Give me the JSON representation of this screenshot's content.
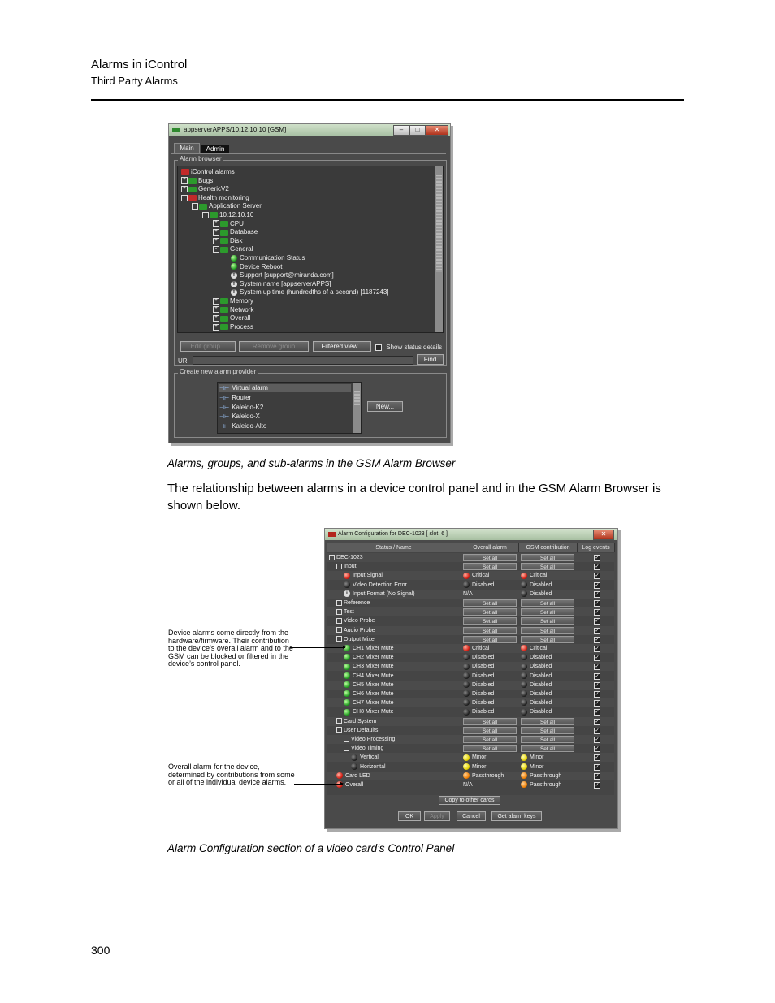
{
  "header": {
    "title": "Alarms in iControl",
    "subtitle": "Third Party Alarms"
  },
  "page_number": "300",
  "caption1": "Alarms, groups, and sub-alarms in the GSM Alarm Browser",
  "body_text": "The relationship between alarms in a device control panel and in the GSM Alarm Browser is shown below.",
  "caption2": "Alarm Configuration section of a video card’s Control Panel",
  "window1": {
    "title": "appserverAPPS/10.12.10.10 [GSM]",
    "tabs": [
      "Main",
      "Admin"
    ],
    "alarm_browser_label": "Alarm browser",
    "tree": [
      {
        "label": "iControl alarms",
        "icon": "folder-red",
        "depth": 0,
        "toggle": ""
      },
      {
        "label": "Bugs",
        "icon": "folder-green",
        "depth": 0,
        "toggle": "+"
      },
      {
        "label": "GenericV2",
        "icon": "folder-green",
        "depth": 0,
        "toggle": "+"
      },
      {
        "label": "Health monitoring",
        "icon": "folder-red",
        "depth": 0,
        "toggle": "-"
      },
      {
        "label": "Application Server",
        "icon": "folder-green",
        "depth": 1,
        "toggle": "-"
      },
      {
        "label": "10.12.10.10",
        "icon": "folder-green",
        "depth": 2,
        "toggle": "-"
      },
      {
        "label": "CPU",
        "icon": "folder-green",
        "depth": 3,
        "toggle": "+"
      },
      {
        "label": "Database",
        "icon": "folder-green",
        "depth": 3,
        "toggle": "+"
      },
      {
        "label": "Disk",
        "icon": "folder-green",
        "depth": 3,
        "toggle": "+"
      },
      {
        "label": "General",
        "icon": "folder-green",
        "depth": 3,
        "toggle": "-"
      },
      {
        "label": "Communication Status",
        "icon": "led-green",
        "depth": 4,
        "toggle": ""
      },
      {
        "label": "Device Reboot",
        "icon": "led-green",
        "depth": 4,
        "toggle": ""
      },
      {
        "label": "Support [support@miranda.com]",
        "icon": "led-t",
        "depth": 4,
        "toggle": ""
      },
      {
        "label": "System name [appserverAPPS]",
        "icon": "led-t",
        "depth": 4,
        "toggle": ""
      },
      {
        "label": "System up time (hundredths of a second) [1187243]",
        "icon": "led-t",
        "depth": 4,
        "toggle": ""
      },
      {
        "label": "Memory",
        "icon": "folder-green",
        "depth": 3,
        "toggle": "+"
      },
      {
        "label": "Network",
        "icon": "folder-green",
        "depth": 3,
        "toggle": "+"
      },
      {
        "label": "Overall",
        "icon": "folder-green",
        "depth": 3,
        "toggle": "+"
      },
      {
        "label": "Process",
        "icon": "folder-green",
        "depth": 3,
        "toggle": "+"
      }
    ],
    "buttons": {
      "edit_label": "Edit group...",
      "remove_label": "Remove group",
      "filtered_label": "Filtered view...",
      "find_label": "Find",
      "new_label": "New..."
    },
    "show_status_label": "Show status details",
    "uri_label": "URI",
    "create_provider_label": "Create new alarm provider",
    "providers": [
      "Virtual alarm",
      "Router",
      "Kaleido-K2",
      "Kaleido-X",
      "Kaleido-Alto"
    ]
  },
  "window2": {
    "title": "Alarm Configuration for DEC-1023 [ slot: 6 ]",
    "headers": [
      "Status / Name",
      "Overall alarm",
      "GSM contribution",
      "Log events"
    ],
    "set_all_label": "Set all",
    "rows": [
      {
        "name": "DEC-1023",
        "indent": 0,
        "icon": "tsq",
        "overall": "set",
        "gsm": "set"
      },
      {
        "name": "Input",
        "indent": 1,
        "icon": "tsq",
        "overall": "set",
        "gsm": "set"
      },
      {
        "name": "Input Signal",
        "indent": 2,
        "icon": "led-red",
        "overall": "Critical",
        "overall_led": "led-red",
        "gsm": "Critical",
        "gsm_led": "led-red"
      },
      {
        "name": "Video Detection Error",
        "indent": 2,
        "icon": "led-dark",
        "overall": "Disabled",
        "overall_led": "led-dark",
        "gsm": "Disabled",
        "gsm_led": "led-dark"
      },
      {
        "name": "Input Format (No Signal)",
        "indent": 2,
        "icon": "led-info",
        "overall": "N/A",
        "overall_led": "",
        "gsm": "Disabled",
        "gsm_led": "led-dark"
      },
      {
        "name": "Reference",
        "indent": 1,
        "icon": "tsq",
        "overall": "set",
        "gsm": "set"
      },
      {
        "name": "Test",
        "indent": 1,
        "icon": "tsq",
        "overall": "set",
        "gsm": "set"
      },
      {
        "name": "Video Probe",
        "indent": 1,
        "icon": "tsq",
        "overall": "set",
        "gsm": "set"
      },
      {
        "name": "Audio Probe",
        "indent": 1,
        "icon": "tsq",
        "overall": "set",
        "gsm": "set"
      },
      {
        "name": "Output Mixer",
        "indent": 1,
        "icon": "tsq",
        "overall": "set",
        "gsm": "set"
      },
      {
        "name": "CH1 Mixer Mute",
        "indent": 2,
        "icon": "led-green",
        "overall": "Critical",
        "overall_led": "led-red",
        "gsm": "Critical",
        "gsm_led": "led-red"
      },
      {
        "name": "CH2 Mixer Mute",
        "indent": 2,
        "icon": "led-green",
        "overall": "Disabled",
        "overall_led": "led-dark",
        "gsm": "Disabled",
        "gsm_led": "led-dark"
      },
      {
        "name": "CH3 Mixer Mute",
        "indent": 2,
        "icon": "led-green",
        "overall": "Disabled",
        "overall_led": "led-dark",
        "gsm": "Disabled",
        "gsm_led": "led-dark"
      },
      {
        "name": "CH4 Mixer Mute",
        "indent": 2,
        "icon": "led-green",
        "overall": "Disabled",
        "overall_led": "led-dark",
        "gsm": "Disabled",
        "gsm_led": "led-dark"
      },
      {
        "name": "CH5 Mixer Mute",
        "indent": 2,
        "icon": "led-green",
        "overall": "Disabled",
        "overall_led": "led-dark",
        "gsm": "Disabled",
        "gsm_led": "led-dark"
      },
      {
        "name": "CH6 Mixer Mute",
        "indent": 2,
        "icon": "led-green",
        "overall": "Disabled",
        "overall_led": "led-dark",
        "gsm": "Disabled",
        "gsm_led": "led-dark"
      },
      {
        "name": "CH7 Mixer Mute",
        "indent": 2,
        "icon": "led-green",
        "overall": "Disabled",
        "overall_led": "led-dark",
        "gsm": "Disabled",
        "gsm_led": "led-dark"
      },
      {
        "name": "CH8 Mixer Mute",
        "indent": 2,
        "icon": "led-green",
        "overall": "Disabled",
        "overall_led": "led-dark",
        "gsm": "Disabled",
        "gsm_led": "led-dark"
      },
      {
        "name": "Card System",
        "indent": 1,
        "icon": "tsq",
        "overall": "set",
        "gsm": "set"
      },
      {
        "name": "User Defaults",
        "indent": 1,
        "icon": "tsq",
        "overall": "set",
        "gsm": "set"
      },
      {
        "name": "Video Processing",
        "indent": 2,
        "icon": "tsq",
        "overall": "set",
        "gsm": "set"
      },
      {
        "name": "Video Timing",
        "indent": 2,
        "icon": "tsq",
        "overall": "set",
        "gsm": "set"
      },
      {
        "name": "Vertical",
        "indent": 3,
        "icon": "led-dark",
        "overall": "Minor",
        "overall_led": "led-yellow",
        "gsm": "Minor",
        "gsm_led": "led-yellow"
      },
      {
        "name": "Horizontal",
        "indent": 3,
        "icon": "led-dark",
        "overall": "Minor",
        "overall_led": "led-yellow",
        "gsm": "Minor",
        "gsm_led": "led-yellow"
      },
      {
        "name": "Card LED",
        "indent": 1,
        "icon": "led-red",
        "overall": "Passthrough",
        "overall_led": "led-orange",
        "gsm": "Passthrough",
        "gsm_led": "led-orange"
      },
      {
        "name": "Overall",
        "indent": 1,
        "icon": "led-red",
        "overall": "N/A",
        "overall_led": "",
        "gsm": "Passthrough",
        "gsm_led": "led-orange"
      }
    ],
    "buttons": {
      "copy_label": "Copy to other cards",
      "ok_label": "OK",
      "apply_label": "Apply",
      "cancel_label": "Cancel",
      "get_keys_label": "Get alarm keys"
    }
  },
  "annotations": {
    "device_alarms": "Device alarms come directly from the hardware/firmware. Their contribution to the device’s overall alarm and to the GSM can be blocked or filtered in the device’s control panel.",
    "overall_alarm": "Overall alarm for the device, determined by contributions from some or all of the individual device alarms."
  }
}
